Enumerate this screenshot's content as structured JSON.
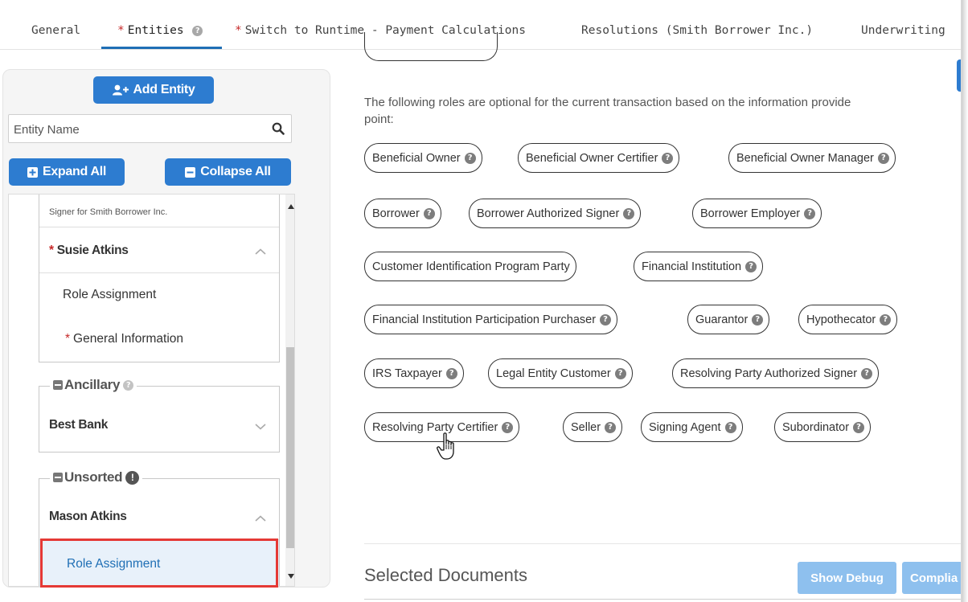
{
  "tabs": [
    {
      "label": "General",
      "required": false
    },
    {
      "label": "Entities",
      "required": true
    },
    {
      "label": "Switch to Runtime - Payment Calculations",
      "required": true
    },
    {
      "label": "Resolutions (Smith Borrower Inc.)",
      "required": false
    },
    {
      "label": "Underwriting",
      "required": false
    }
  ],
  "required_marker": "*",
  "help_glyph": "?",
  "left_panel": {
    "add_entity_label": "Add Entity",
    "search_placeholder": "Entity Name",
    "expand_all_label": "Expand All",
    "collapse_all_label": "Collapse All",
    "tree": {
      "signer_caption": "Signer for Smith Borrower Inc.",
      "susie_name": "Susie Atkins",
      "susie_items": [
        "Role Assignment",
        "General Information"
      ],
      "ancillary_legend": "Ancillary",
      "best_bank": "Best Bank",
      "unsorted_legend": "Unsorted",
      "unsorted_badge": "!",
      "mason_name": "Mason Atkins",
      "mason_items": [
        "Role Assignment"
      ]
    }
  },
  "main": {
    "optional_text_line1": "The following roles are optional for the current transaction based on the information provide",
    "optional_text_line2": "point:",
    "roles": [
      "Beneficial Owner",
      "Beneficial Owner Certifier",
      "Beneficial Owner Manager",
      "Borrower",
      "Borrower Authorized Signer",
      "Borrower Employer",
      "Customer Identification Program Party",
      "Financial Institution",
      "Financial Institution Participation Purchaser",
      "Guarantor",
      "Hypothecator",
      "IRS Taxpayer",
      "Legal Entity Customer",
      "Resolving Party Authorized Signer",
      "Resolving Party Certifier",
      "Seller",
      "Signing Agent",
      "Subordinator"
    ],
    "selected_documents_title": "Selected Documents",
    "show_debug_label": "Show Debug",
    "compliance_label": "Complia"
  },
  "colors": {
    "primary": "#2d7cd0",
    "tab_active": "#1f6fb5",
    "required": "#c62828",
    "highlight": "#e53935",
    "selected_bg": "#e8f1fa",
    "light_button": "#8ec0ee"
  }
}
